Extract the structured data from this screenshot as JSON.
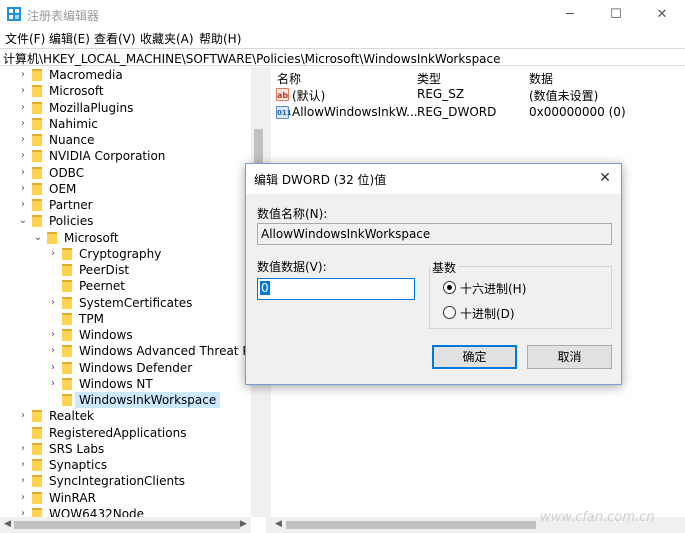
{
  "window": {
    "title": "注册表编辑器",
    "minimize": "─",
    "maximize": "☐",
    "close": "✕"
  },
  "menu": {
    "file": "文件(F)",
    "edit": "编辑(E)",
    "view": "查看(V)",
    "favorites": "收藏夹(A)",
    "help": "帮助(H)"
  },
  "address": "计算机\\HKEY_LOCAL_MACHINE\\SOFTWARE\\Policies\\Microsoft\\WindowsInkWorkspace",
  "tree": {
    "items": [
      {
        "label": "Macromedia",
        "depth": 0,
        "expander": "›"
      },
      {
        "label": "Microsoft",
        "depth": 0,
        "expander": "›"
      },
      {
        "label": "MozillaPlugins",
        "depth": 0,
        "expander": "›"
      },
      {
        "label": "Nahimic",
        "depth": 0,
        "expander": "›"
      },
      {
        "label": "Nuance",
        "depth": 0,
        "expander": "›"
      },
      {
        "label": "NVIDIA Corporation",
        "depth": 0,
        "expander": "›"
      },
      {
        "label": "ODBC",
        "depth": 0,
        "expander": "›"
      },
      {
        "label": "OEM",
        "depth": 0,
        "expander": "›"
      },
      {
        "label": "Partner",
        "depth": 0,
        "expander": "›"
      },
      {
        "label": "Policies",
        "depth": 0,
        "expander": "⌄"
      },
      {
        "label": "Microsoft",
        "depth": 1,
        "expander": "⌄"
      },
      {
        "label": "Cryptography",
        "depth": 2,
        "expander": "›"
      },
      {
        "label": "PeerDist",
        "depth": 2,
        "expander": ""
      },
      {
        "label": "Peernet",
        "depth": 2,
        "expander": ""
      },
      {
        "label": "SystemCertificates",
        "depth": 2,
        "expander": "›"
      },
      {
        "label": "TPM",
        "depth": 2,
        "expander": ""
      },
      {
        "label": "Windows",
        "depth": 2,
        "expander": "›"
      },
      {
        "label": "Windows Advanced Threat Pro",
        "depth": 2,
        "expander": "›"
      },
      {
        "label": "Windows Defender",
        "depth": 2,
        "expander": "›"
      },
      {
        "label": "Windows NT",
        "depth": 2,
        "expander": "›"
      },
      {
        "label": "WindowsInkWorkspace",
        "depth": 2,
        "expander": "",
        "selected": true
      },
      {
        "label": "Realtek",
        "depth": 0,
        "expander": "›"
      },
      {
        "label": "RegisteredApplications",
        "depth": 0,
        "expander": ""
      },
      {
        "label": "SRS Labs",
        "depth": 0,
        "expander": "›"
      },
      {
        "label": "Synaptics",
        "depth": 0,
        "expander": "›"
      },
      {
        "label": "SyncIntegrationClients",
        "depth": 0,
        "expander": "›"
      },
      {
        "label": "WinRAR",
        "depth": 0,
        "expander": "›"
      },
      {
        "label": "WOW6432Node",
        "depth": 0,
        "expander": "›"
      }
    ]
  },
  "list": {
    "headers": {
      "name": "名称",
      "type": "类型",
      "data": "数据"
    },
    "rows": [
      {
        "icon": "string-value-icon",
        "icon_text": "ab",
        "name": "(默认)",
        "type": "REG_SZ",
        "data": "(数值未设置)"
      },
      {
        "icon": "dword-value-icon",
        "icon_text": "011",
        "name": "AllowWindowsInkW...",
        "type": "REG_DWORD",
        "data": "0x00000000 (0)"
      }
    ]
  },
  "watermark": "www.cfan.com.cn",
  "dialog": {
    "title": "编辑 DWORD (32 位)值",
    "close": "✕",
    "value_name_label": "数值名称(N):",
    "value_name": "AllowWindowsInkWorkspace",
    "value_data_label": "数值数据(V):",
    "value_data": "0",
    "base_label": "基数",
    "radio_hex": "十六进制(H)",
    "radio_dec": "十进制(D)",
    "selected_base": "hex",
    "ok": "确定",
    "cancel": "取消"
  },
  "colors": {
    "selection": "#cce8ff",
    "accent": "#0078d7",
    "folder": "#ffd452"
  }
}
